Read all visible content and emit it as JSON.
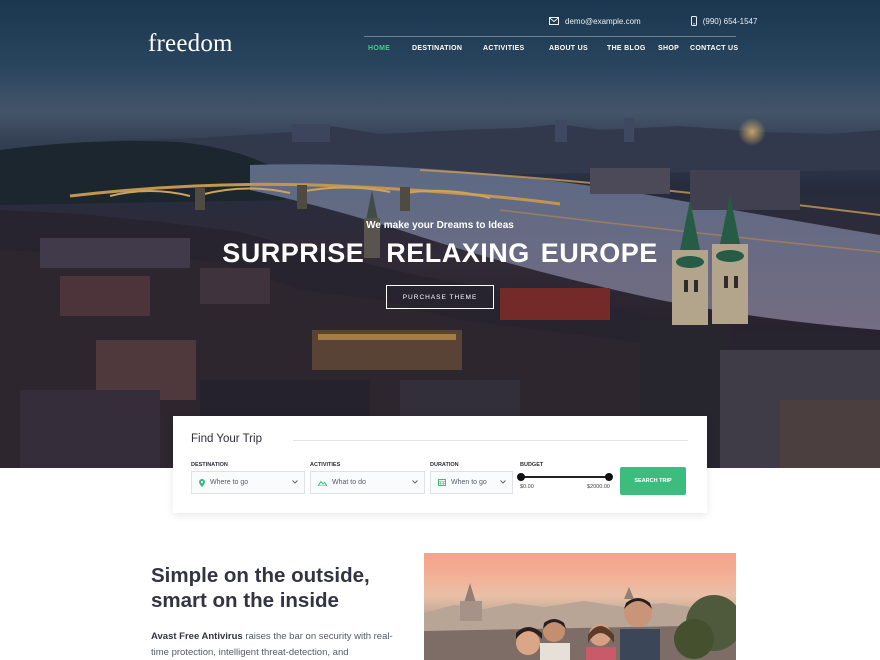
{
  "brand": {
    "logo_text": "freedom"
  },
  "topbar": {
    "email": "demo@example.com",
    "phone": "(990) 654-1547",
    "email_icon": "envelope-icon",
    "phone_icon": "phone-icon"
  },
  "nav": {
    "items": [
      {
        "label": "HOME",
        "active": true
      },
      {
        "label": "DESTINATION",
        "active": false
      },
      {
        "label": "ACTIVITIES",
        "active": false
      },
      {
        "label": "ABOUT US",
        "active": false
      },
      {
        "label": "THE BLOG",
        "active": false
      },
      {
        "label": "SHOP",
        "active": false
      },
      {
        "label": "CONTACT US",
        "active": false
      }
    ]
  },
  "hero": {
    "tagline": "We make your Dreams to Ideas",
    "headline": "SURPRISE  RELAXING EUROPE",
    "cta_label": "PURCHASE THEME"
  },
  "search": {
    "title": "Find Your Trip",
    "destination": {
      "label": "DESTINATION",
      "placeholder": "Where to go",
      "icon": "map-pin-icon"
    },
    "activities": {
      "label": "ACTIVITIES",
      "placeholder": "What to do",
      "icon": "mountain-icon"
    },
    "duration": {
      "label": "DURATION",
      "placeholder": "When to go",
      "icon": "calendar-icon"
    },
    "budget": {
      "label": "BUDGET",
      "min_label": "$0.00",
      "max_label": "$2000.00",
      "min_fraction": 0,
      "max_fraction": 1
    },
    "button_label": "SEARCH TRIP"
  },
  "feature": {
    "title_line1": "Simple on the outside,",
    "title_line2": "smart on the inside",
    "body_bold": "Avast Free Antivirus",
    "body_rest": " raises the bar on security with real-time protection, intelligent threat-detection, and"
  },
  "colors": {
    "accent": "#3dbd7d",
    "nav_active": "#4ecb8a",
    "heading": "#333344"
  }
}
